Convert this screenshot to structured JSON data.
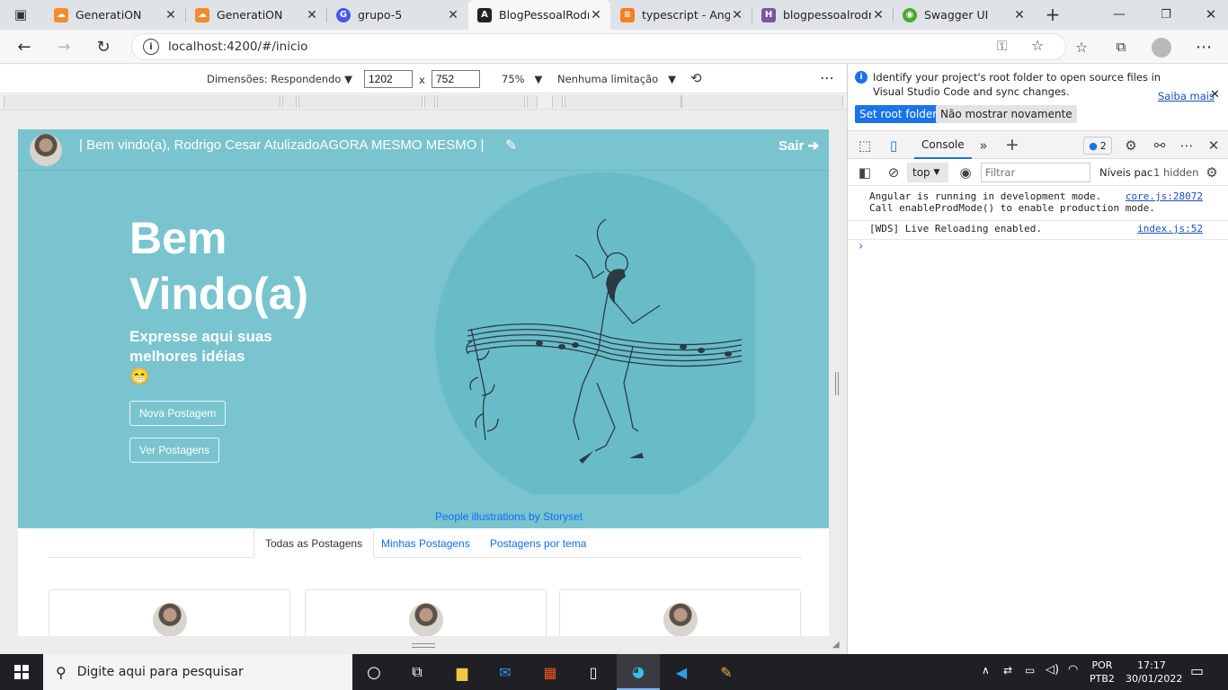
{
  "browser": {
    "tabs": [
      {
        "label": "GeneratiON",
        "icon": "cloud-icon",
        "color": "#f18d2e",
        "active": false
      },
      {
        "label": "GeneratiON",
        "icon": "cloud-icon",
        "color": "#f18d2e",
        "active": false
      },
      {
        "label": "grupo-5",
        "icon": "google-icon",
        "color": "#4659ea",
        "active": false
      },
      {
        "label": "BlogPessoalRodri",
        "icon": "angular-icon",
        "color": "#222222",
        "active": true
      },
      {
        "label": "typescript - Angu",
        "icon": "stackoverflow-icon",
        "color": "#f48024",
        "active": false
      },
      {
        "label": "blogpessoalrodri",
        "icon": "heroku-icon",
        "color": "#79589f",
        "active": false
      },
      {
        "label": "Swagger UI",
        "icon": "swagger-icon",
        "color": "#49a82b",
        "active": false
      }
    ],
    "url": "localhost:4200/#/inicio"
  },
  "device_toolbar": {
    "dimensions_label": "Dimensões: Respondendo",
    "width": "1202",
    "times": "x",
    "height": "752",
    "zoom": "75%",
    "throttle": "Nenhuma limitação"
  },
  "site": {
    "header_text": "| Bem vindo(a), Rodrigo Cesar AtulizadoAGORA MESMO MESMO |",
    "logout": "Sair",
    "hero_title_line1": "Bem",
    "hero_title_line2": "Vindo(a)",
    "hero_subtitle_line1": "Expresse aqui suas",
    "hero_subtitle_line2": "melhores idéias",
    "emoji": "😁",
    "new_post_button": "Nova Postagem",
    "view_posts_button": "Ver Postagens",
    "credit": "People illustrations by Storyset",
    "tabs": [
      "Todas as Postagens",
      "Minhas Postagens",
      "Postagens por tema"
    ]
  },
  "devtools": {
    "banner_text_line1": "Identify your project's root folder to open source files in",
    "banner_text_line2": "Visual Studio Code and sync changes.",
    "learn_more": "Saiba mais",
    "set_root": "Set root folder",
    "dont_show": "Não mostrar novamente",
    "console_tab": "Console",
    "issues_count": "2",
    "context": "top",
    "filter_placeholder": "Filtrar",
    "levels": "Níveis pac",
    "hidden": "1 hidden",
    "log1_line1": "Angular is running in development mode.",
    "log1_line2": "Call enableProdMode() to enable production mode.",
    "log1_src": "core.js:28072",
    "log2": "[WDS] Live Reloading enabled.",
    "log2_src": "index.js:52"
  },
  "taskbar": {
    "search_placeholder": "Digite aqui para pesquisar",
    "lang1": "POR",
    "lang2": "PTB2",
    "time": "17:17",
    "date": "30/01/2022"
  }
}
